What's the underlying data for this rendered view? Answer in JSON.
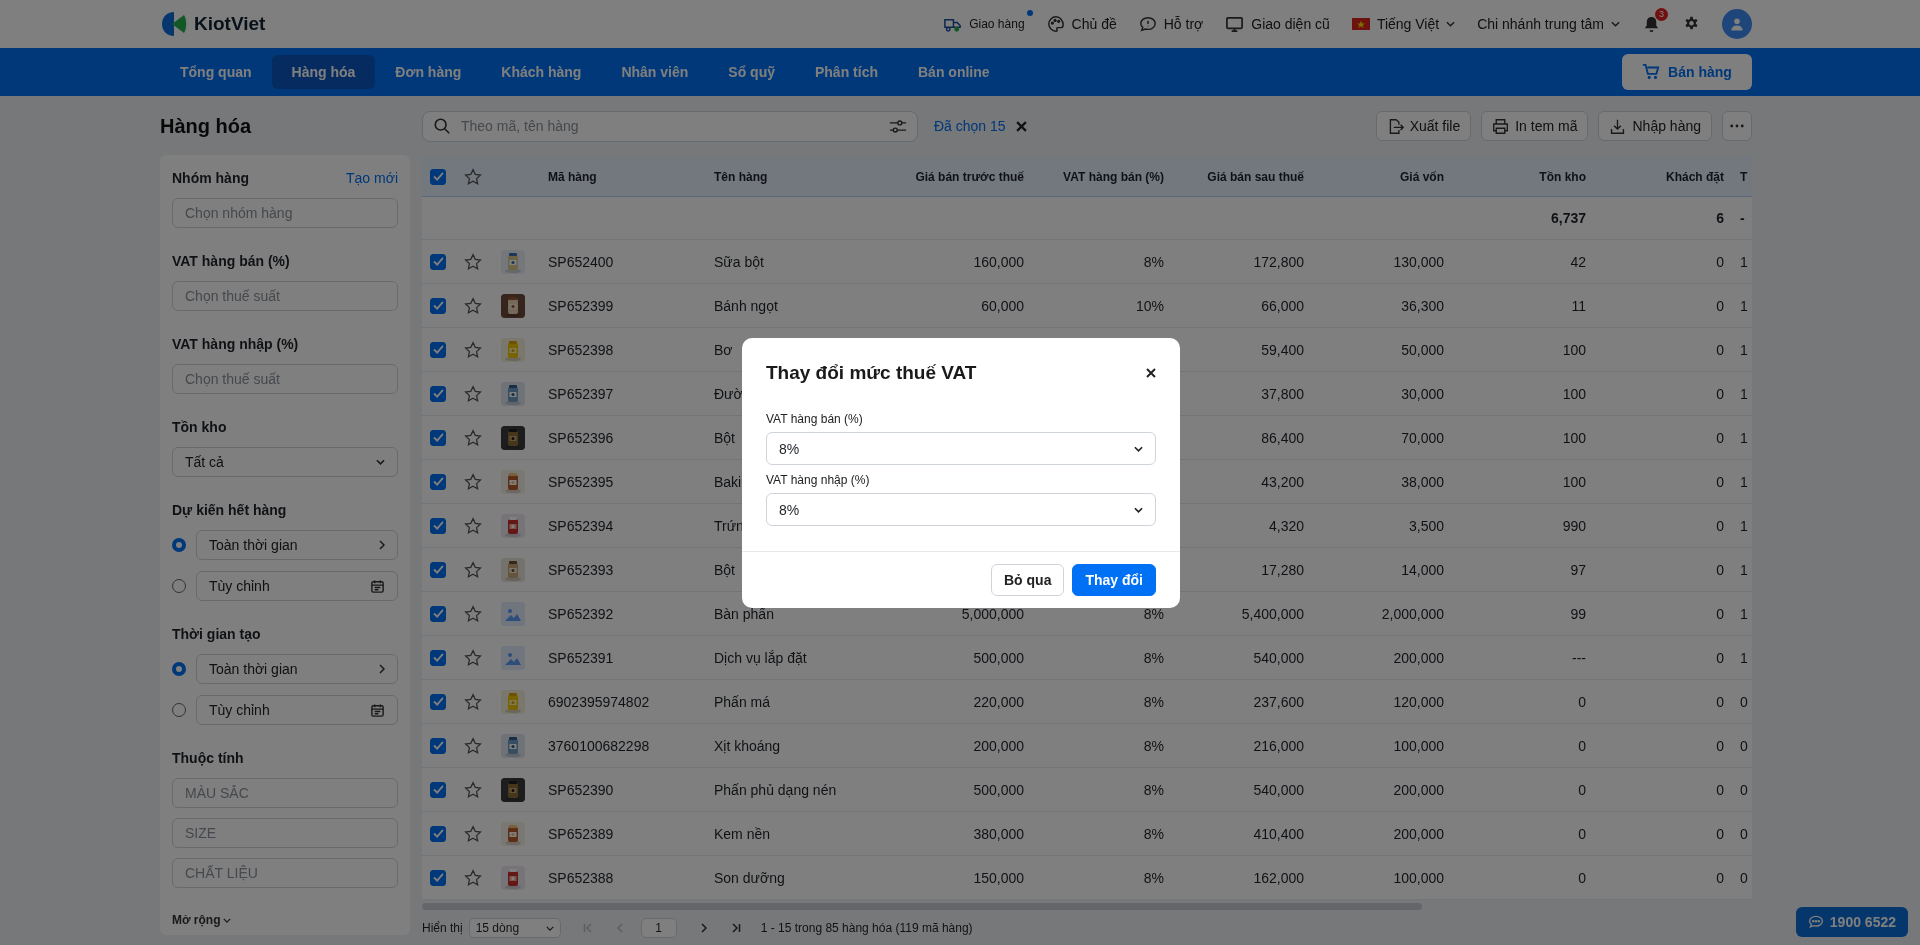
{
  "header": {
    "logo": "KiotViet",
    "links": [
      {
        "label": "Giao hàng",
        "dot": true
      },
      {
        "label": "Chủ đề",
        "dot": false
      },
      {
        "label": "Hỗ trợ",
        "dot": false
      },
      {
        "label": "Giao diện cũ",
        "dot": false
      }
    ],
    "language": "Tiếng Việt",
    "branch": "Chi nhánh trung tâm",
    "notification_count": "3"
  },
  "nav": {
    "tabs": [
      {
        "label": "Tổng quan",
        "selected": false
      },
      {
        "label": "Hàng hóa",
        "selected": true
      },
      {
        "label": "Đơn hàng",
        "selected": false
      },
      {
        "label": "Khách hàng",
        "selected": false
      },
      {
        "label": "Nhân viên",
        "selected": false
      },
      {
        "label": "Sổ quỹ",
        "selected": false
      },
      {
        "label": "Phân tích",
        "selected": false
      },
      {
        "label": "Bán online",
        "selected": false
      }
    ],
    "sell_button": "Bán hàng"
  },
  "sidebar": {
    "title": "Hàng hóa",
    "filters": [
      {
        "kind": "field",
        "label": "Nhóm hàng",
        "action": "Tạo mới",
        "placeholder": "Chọn nhóm hàng"
      },
      {
        "kind": "field",
        "label": "VAT hàng bán (%)",
        "placeholder": "Chọn thuế suất"
      },
      {
        "kind": "field",
        "label": "VAT hàng nhập (%)",
        "placeholder": "Chọn thuế suất"
      },
      {
        "kind": "dropdown",
        "label": "Tồn kho",
        "value": "Tất cả"
      },
      {
        "kind": "radio",
        "label": "Dự kiến hết hàng",
        "options": [
          {
            "label": "Toàn thời gian",
            "selected": true,
            "kind": "preset"
          },
          {
            "label": "Tùy chỉnh",
            "selected": false,
            "kind": "custom"
          }
        ]
      },
      {
        "kind": "radio",
        "label": "Thời gian tạo",
        "options": [
          {
            "label": "Toàn thời gian",
            "selected": true,
            "kind": "preset"
          },
          {
            "label": "Tùy chỉnh",
            "selected": false,
            "kind": "custom"
          }
        ]
      },
      {
        "kind": "fields",
        "label": "Thuộc tính",
        "placeholders": [
          "MÀU SẮC",
          "SIZE",
          "CHẤT LIỆU"
        ]
      }
    ],
    "more": "Mở rộng"
  },
  "toolbar": {
    "search_placeholder": "Theo mã, tên hàng",
    "selection": "Đã chọn 15",
    "actions": [
      {
        "label": "Xuất file"
      },
      {
        "label": "In tem mã"
      },
      {
        "label": "Nhập hàng"
      }
    ]
  },
  "table": {
    "all_selected": true,
    "columns": [
      "Mã hàng",
      "Tên hàng",
      "Giá bán trước thuế",
      "VAT hàng bán (%)",
      "Giá bán sau thuế",
      "Giá vốn",
      "Tồn kho",
      "Khách đặt",
      "T"
    ],
    "totals": {
      "stock": "6,737",
      "ordered": "6",
      "column_10": "-"
    },
    "rows": [
      {
        "selected": true,
        "code": "SP652400",
        "name": "Sữa bột",
        "price": "160,000",
        "vat": "8%",
        "after_tax": "172,800",
        "cost": "130,000",
        "stock": "42",
        "ordered": "0",
        "column_10": "1"
      },
      {
        "selected": true,
        "code": "SP652399",
        "name": "Bánh ngọt",
        "price": "60,000",
        "vat": "10%",
        "after_tax": "66,000",
        "cost": "36,300",
        "stock": "11",
        "ordered": "0",
        "column_10": "1"
      },
      {
        "selected": true,
        "code": "SP652398",
        "name": "Bơ",
        "after_tax": "59,400",
        "cost": "50,000",
        "stock": "100",
        "ordered": "0",
        "column_10": "1"
      },
      {
        "selected": true,
        "code": "SP652397",
        "name": "Đườ",
        "after_tax": "37,800",
        "cost": "30,000",
        "stock": "100",
        "ordered": "0",
        "column_10": "1"
      },
      {
        "selected": true,
        "code": "SP652396",
        "name": "Bột",
        "after_tax": "86,400",
        "cost": "70,000",
        "stock": "100",
        "ordered": "0",
        "column_10": "1"
      },
      {
        "selected": true,
        "code": "SP652395",
        "name": "Baki",
        "after_tax": "43,200",
        "cost": "38,000",
        "stock": "100",
        "ordered": "0",
        "column_10": "1"
      },
      {
        "selected": true,
        "code": "SP652394",
        "name": "Trứn",
        "after_tax": "4,320",
        "cost": "3,500",
        "stock": "990",
        "ordered": "0",
        "column_10": "1"
      },
      {
        "selected": true,
        "code": "SP652393",
        "name": "Bột",
        "after_tax": "17,280",
        "cost": "14,000",
        "stock": "97",
        "ordered": "0",
        "column_10": "1"
      },
      {
        "selected": true,
        "kind": "placeholder",
        "code": "SP652392",
        "name": "Bàn phấn",
        "price": "5,000,000",
        "vat": "8%",
        "after_tax": "5,400,000",
        "cost": "2,000,000",
        "stock": "99",
        "ordered": "0",
        "column_10": "1"
      },
      {
        "selected": true,
        "kind": "placeholder",
        "code": "SP652391",
        "name": "Dịch vụ lắp đặt",
        "price": "500,000",
        "vat": "8%",
        "after_tax": "540,000",
        "cost": "200,000",
        "stock": "---",
        "ordered": "0",
        "column_10": "1"
      },
      {
        "selected": true,
        "code": "6902395974802",
        "name": "Phấn má",
        "price": "220,000",
        "vat": "8%",
        "after_tax": "237,600",
        "cost": "120,000",
        "stock": "0",
        "ordered": "0",
        "column_10": "0"
      },
      {
        "selected": true,
        "code": "3760100682298",
        "name": "Xịt khoáng",
        "price": "200,000",
        "vat": "8%",
        "after_tax": "216,000",
        "cost": "100,000",
        "stock": "0",
        "ordered": "0",
        "column_10": "0"
      },
      {
        "selected": true,
        "code": "SP652390",
        "name": "Phấn phủ dạng nén",
        "price": "500,000",
        "vat": "8%",
        "after_tax": "540,000",
        "cost": "200,000",
        "stock": "0",
        "ordered": "0",
        "column_10": "0"
      },
      {
        "selected": true,
        "code": "SP652389",
        "name": "Kem nền",
        "price": "380,000",
        "vat": "8%",
        "after_tax": "410,400",
        "cost": "200,000",
        "stock": "0",
        "ordered": "0",
        "column_10": "0"
      },
      {
        "selected": true,
        "code": "SP652388",
        "name": "Son dưỡng",
        "price": "150,000",
        "vat": "8%",
        "after_tax": "162,000",
        "cost": "100,000",
        "stock": "0",
        "ordered": "0",
        "column_10": "0"
      }
    ]
  },
  "pagination": {
    "label": "Hiển thị",
    "page_size": "15 dòng",
    "page": "1",
    "summary": "1 - 15 trong 85 hàng hóa (119 mã hàng)"
  },
  "hotline": "1900 6522",
  "dialog": {
    "title": "Thay đổi mức thuế VAT",
    "fields": [
      {
        "label": "VAT hàng bán (%)",
        "value": "8%"
      },
      {
        "label": "VAT hàng nhập (%)",
        "value": "8%"
      }
    ],
    "buttons": [
      {
        "label": "Bỏ qua",
        "kind": "secondary"
      },
      {
        "label": "Thay đổi",
        "kind": "primary"
      }
    ]
  }
}
